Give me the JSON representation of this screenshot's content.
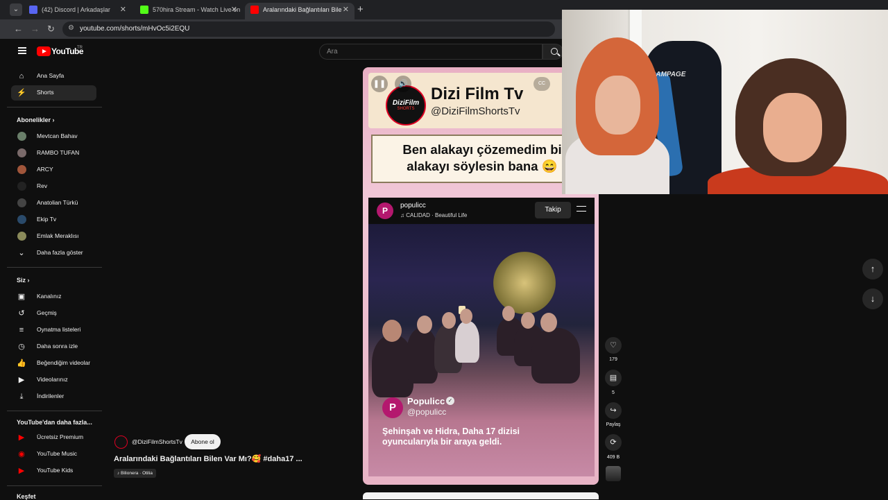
{
  "browser": {
    "tabs": [
      {
        "title": "(42) Discord | Arkadaşlar",
        "color": "#5865f2"
      },
      {
        "title": "570hira Stream - Watch Live on",
        "color": "#53fc18"
      },
      {
        "title": "Aralarındaki Bağlantıları Bile",
        "color": "#ff0000"
      }
    ],
    "url": "youtube.com/shorts/mHvOc5i2EQU"
  },
  "masthead": {
    "logo": "YouTube",
    "country": "TR",
    "search_placeholder": "Ara"
  },
  "sidebar": {
    "main": [
      {
        "label": "Ana Sayfa",
        "icon": "home-icon"
      },
      {
        "label": "Shorts",
        "icon": "shorts-icon"
      }
    ],
    "subscriptions_title": "Abonelikler",
    "subscriptions": [
      {
        "label": "Mevtcan Bahav",
        "color": "#6a7f6a"
      },
      {
        "label": "RAMBO TUFAN",
        "color": "#7a6a6a"
      },
      {
        "label": "ARCY",
        "color": "#a0553a"
      },
      {
        "label": "Rev",
        "color": "#222222"
      },
      {
        "label": "Anatolian Türkü",
        "color": "#444444"
      },
      {
        "label": "Ekip Tv",
        "color": "#2a4a6a"
      },
      {
        "label": "Emlak Meraklısı",
        "color": "#8a8a5a"
      }
    ],
    "show_more": "Daha fazla göster",
    "you_title": "Siz",
    "you": [
      {
        "label": "Kanalınız",
        "icon": "channel-icon"
      },
      {
        "label": "Geçmiş",
        "icon": "history-icon"
      },
      {
        "label": "Oynatma listeleri",
        "icon": "playlist-icon"
      },
      {
        "label": "Daha sonra izle",
        "icon": "clock-icon"
      },
      {
        "label": "Beğendiğim videolar",
        "icon": "thumbs-up-icon"
      },
      {
        "label": "Videolarınız",
        "icon": "video-icon"
      },
      {
        "label": "İndirilenler",
        "icon": "download-icon"
      }
    ],
    "more_title": "YouTube'dan daha fazla...",
    "more": [
      {
        "label": "Ücretsiz Premium"
      },
      {
        "label": "YouTube Music"
      },
      {
        "label": "YouTube Kids"
      }
    ],
    "explore_title": "Keşfet"
  },
  "short": {
    "banner_logo": "DiziFilm",
    "banner_logo_sub": "SHORTS",
    "banner_title": "Dizi Film Tv",
    "banner_handle": "@DiziFilmShortsTv",
    "caption_line1": "Ben alakayı çözemedim bi",
    "caption_line2": "alakayı söylesin bana 😄",
    "cc": "CC",
    "embed": {
      "avatar_letter": "P",
      "name": "populicc",
      "music": "♫ CALIDAD · Beautiful Life",
      "follow": "Takip",
      "overlay_name": "Populicc",
      "overlay_handle": "@populicc",
      "overlay_text": "Şehinşah ve Hidra, Daha 17 dizisi oyuncularıyla bir araya geldi."
    }
  },
  "actions": {
    "likes": "179",
    "comments": "5",
    "share": "Paylaş",
    "remix": "409 B"
  },
  "channel": {
    "name": "@DiziFilmShortsTv",
    "subscribe": "Abone ol",
    "title": "Aralarındaki Bağlantıları Bilen Var Mı?🥰 #daha17 ...",
    "music": "♪ Bilionera · Otilia"
  },
  "webcam": {
    "chair_brand": "RAMPAGE"
  }
}
